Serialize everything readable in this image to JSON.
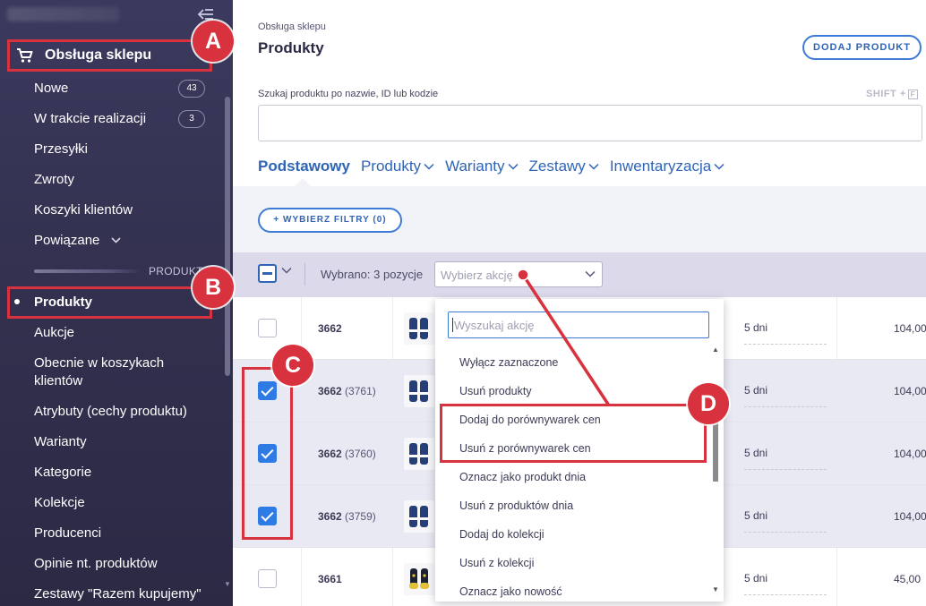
{
  "sidebar": {
    "section_label": "Obsługa sklepu",
    "items": [
      {
        "label": "Nowe",
        "badge": "43"
      },
      {
        "label": "W trakcie realizacji",
        "badge": "3"
      },
      {
        "label": "Przesyłki"
      },
      {
        "label": "Zwroty"
      },
      {
        "label": "Koszyki klientów"
      },
      {
        "label": "Powiązane"
      }
    ],
    "divider_label": "PRODUKT",
    "product_items": [
      {
        "label": "Produkty",
        "active": true
      },
      {
        "label": "Aukcje"
      },
      {
        "label": "Obecnie w koszykach klientów"
      },
      {
        "label": "Atrybuty (cechy produktu)"
      },
      {
        "label": "Warianty"
      },
      {
        "label": "Kategorie"
      },
      {
        "label": "Kolekcje"
      },
      {
        "label": "Producenci"
      },
      {
        "label": "Opinie nt. produktów"
      },
      {
        "label": "Zestawy \"Razem kupujemy\""
      }
    ]
  },
  "header": {
    "breadcrumb": "Obsługa sklepu",
    "title": "Produkty",
    "add_button": "DODAJ PRODUKT"
  },
  "search": {
    "label": "Szukaj produktu po nazwie, ID lub kodzie",
    "shortcut": "SHIFT +",
    "shortcut_key": "F",
    "value": ""
  },
  "tabs": [
    {
      "label": "Podstawowy",
      "active": true
    },
    {
      "label": "Produkty"
    },
    {
      "label": "Warianty"
    },
    {
      "label": "Zestawy"
    },
    {
      "label": "Inwentaryzacja"
    }
  ],
  "filters": {
    "button": "+ WYBIERZ FILTRY (0)"
  },
  "bulk": {
    "selected_text": "Wybrano: 3 pozycje",
    "action_placeholder": "Wybierz akcję"
  },
  "rows": [
    {
      "id": "3662",
      "variant": "",
      "checked": false,
      "days": "5 dni",
      "price": "104,00"
    },
    {
      "id": "3662",
      "variant": "(3761)",
      "checked": true,
      "days": "5 dni",
      "price": "104,00"
    },
    {
      "id": "3662",
      "variant": "(3760)",
      "checked": true,
      "days": "5 dni",
      "price": "104,00"
    },
    {
      "id": "3662",
      "variant": "(3759)",
      "checked": true,
      "days": "5 dni",
      "price": "104,00"
    },
    {
      "id": "3661",
      "variant": "",
      "checked": false,
      "days": "5 dni",
      "price": "45,00"
    }
  ],
  "dropdown": {
    "search_placeholder": "Wyszukaj akcję",
    "items": [
      "Wyłącz zaznaczone",
      "Usuń produkty",
      "Dodaj do porównywarek cen",
      "Usuń z porównywarek cen",
      "Oznacz jako produkt dnia",
      "Usuń z produktów dnia",
      "Dodaj do kolekcji",
      "Usuń z kolekcji",
      "Oznacz jako nowość"
    ]
  },
  "annotations": {
    "markers": [
      "A",
      "B",
      "C",
      "D"
    ],
    "color": "#d8323f"
  },
  "colors": {
    "accent": "#2f64b6",
    "sidebar_bg": "#35334f",
    "checkbox_checked": "#2f7be6",
    "annotation": "#d8323f"
  },
  "icons": {
    "section": "cart-icon",
    "collapse": "collapse-sidebar-icon",
    "chevron": "chevron-down-icon"
  }
}
